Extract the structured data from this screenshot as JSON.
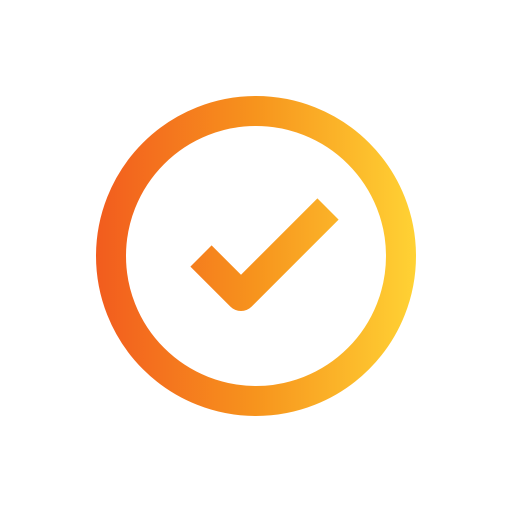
{
  "icon": {
    "name": "check-circle-icon",
    "gradient": {
      "start": "#F25C1E",
      "mid": "#F7941D",
      "end": "#FFD234"
    },
    "background": "#FFFFFF"
  }
}
